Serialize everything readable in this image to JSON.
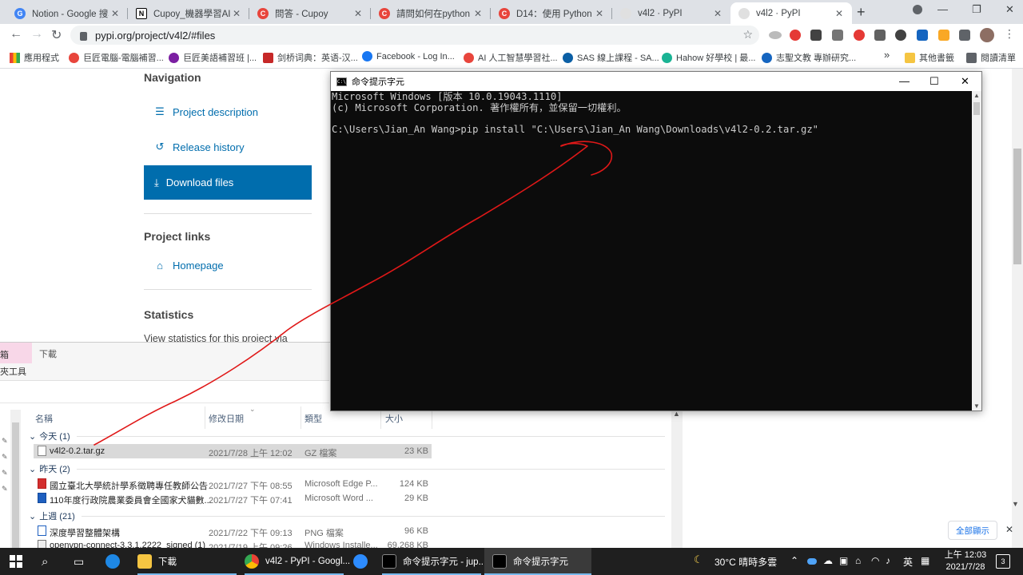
{
  "browser": {
    "tabs": [
      {
        "label": "Notion - Google 搜尋",
        "favicon": "G",
        "color": "#4285f4"
      },
      {
        "label": "Cupoy_機器學習AI助",
        "favicon": "N",
        "color": "#000000"
      },
      {
        "label": "問答 - Cupoy",
        "favicon": "C",
        "color": "#e8453c"
      },
      {
        "label": "請問如何在python ic",
        "favicon": "C",
        "color": "#e8453c"
      },
      {
        "label": "D14：使用 Python 進",
        "favicon": "C",
        "color": "#e8453c"
      },
      {
        "label": "v4l2 · PyPI",
        "favicon": "",
        "color": "#cccccc"
      },
      {
        "label": "v4l2 · PyPI",
        "favicon": "",
        "color": "#cccccc"
      }
    ],
    "new_tab": "+",
    "url": "pypi.org/project/v4l2/#files",
    "bookmarks": [
      {
        "label": "應用程式",
        "color": "#ea4335"
      },
      {
        "label": "巨匠電腦-電腦補習...",
        "color": "#e8453c"
      },
      {
        "label": "巨匠美語補習班 |...",
        "color": "#7b1fa2"
      },
      {
        "label": "剑桥词典：英语-汉...",
        "color": "#c62828"
      },
      {
        "label": "Facebook - Log In...",
        "color": "#1877f2"
      },
      {
        "label": "AI 人工智慧學習社...",
        "color": "#e8453c"
      },
      {
        "label": "SAS 線上課程 - SA...",
        "color": "#0b5fa5"
      },
      {
        "label": "Hahow 好學校 | 最...",
        "color": "#1ab394"
      },
      {
        "label": "志聖文教 專辦研究...",
        "color": "#1565c0"
      }
    ],
    "bookmarks_more": "»",
    "other_bookmarks": "其他書籤",
    "reading_list": "閱讀清單"
  },
  "pypi": {
    "navigation_heading": "Navigation",
    "nav_links": [
      {
        "label": "Project description",
        "icon": "list-icon"
      },
      {
        "label": "Release history",
        "icon": "history-icon"
      },
      {
        "label": "Download files",
        "icon": "download-icon"
      }
    ],
    "project_links_heading": "Project links",
    "homepage_label": "Homepage",
    "statistics_heading": "Statistics",
    "statistics_text": "View statistics for this project via"
  },
  "cmd": {
    "title": "命令提示字元",
    "lines": [
      "Microsoft Windows [版本 10.0.19043.1110]",
      "(c) Microsoft Corporation. 著作權所有，並保留一切權利。",
      "",
      "C:\\Users\\Jian_An Wang>pip install \"C:\\Users\\Jian_An Wang\\Downloads\\v4l2-0.2.tar.gz\""
    ]
  },
  "explorer": {
    "ribbon_tab": "下載",
    "ribbon_left_top": "箱",
    "ribbon_left_bottom": "夾工具",
    "columns": [
      "名稱",
      "修改日期",
      "類型",
      "大小"
    ],
    "groups": [
      {
        "label": "今天 (1)",
        "files": [
          {
            "name": "v4l2-0.2.tar.gz",
            "date": "2021/7/28 上午 12:02",
            "type": "GZ 檔案",
            "size": "23 KB",
            "selected": true
          }
        ]
      },
      {
        "label": "昨天 (2)",
        "files": [
          {
            "name": "國立臺北大學統計學系徵聘專任教師公告",
            "date": "2021/7/27 下午 08:55",
            "type": "Microsoft Edge P...",
            "size": "124 KB"
          },
          {
            "name": "110年度行政院農業委員會全國家犬貓數...",
            "date": "2021/7/27 下午 07:41",
            "type": "Microsoft Word ...",
            "size": "29 KB"
          }
        ]
      },
      {
        "label": "上週 (21)",
        "files": [
          {
            "name": "深度學習整體架構",
            "date": "2021/7/22 下午 09:13",
            "type": "PNG 檔案",
            "size": "96 KB"
          },
          {
            "name": "openvpn-connect-3.3.1.2222_signed (1)",
            "date": "2021/7/19 上午 09:26",
            "type": "Windows Installe...",
            "size": "69,268 KB"
          }
        ]
      }
    ]
  },
  "download_bar": {
    "show_all": "全部顯示",
    "close": "✕"
  },
  "taskbar": {
    "apps": [
      {
        "label": "下載"
      },
      {
        "label": "v4l2 - PyPI - Googl..."
      },
      {
        "label": "命令提示字元 - jup..."
      },
      {
        "label": "命令提示字元"
      }
    ],
    "weather": "30°C  晴時多雲",
    "ime": "英",
    "time": "上午 12:03",
    "date": "2021/7/28",
    "notifications": "3"
  }
}
